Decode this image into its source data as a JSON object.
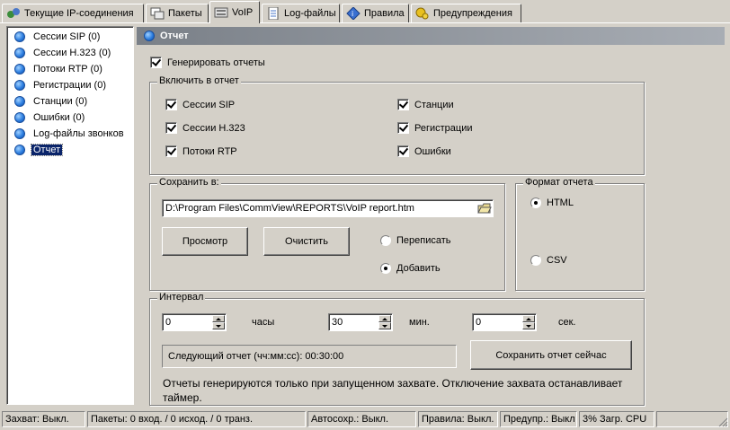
{
  "tabs": [
    {
      "label": "Текущие IP-соединения",
      "icon": "ip-connections-icon"
    },
    {
      "label": "Пакеты",
      "icon": "packets-icon"
    },
    {
      "label": "VoIP",
      "icon": "voip-icon"
    },
    {
      "label": "Log-файлы",
      "icon": "log-files-icon"
    },
    {
      "label": "Правила",
      "icon": "rules-icon"
    },
    {
      "label": "Предупреждения",
      "icon": "alerts-icon"
    }
  ],
  "sidebar": {
    "items": [
      {
        "label": "Сессии SIP  (0)"
      },
      {
        "label": "Сессии H.323 (0)"
      },
      {
        "label": "Потоки RTP (0)"
      },
      {
        "label": "Регистрации (0)"
      },
      {
        "label": "Станции (0)"
      },
      {
        "label": "Ошибки (0)"
      },
      {
        "label": "Log-файлы звонков"
      },
      {
        "label": "Отчет"
      }
    ]
  },
  "header": {
    "title": "Отчет"
  },
  "generate": {
    "label": "Генерировать отчеты",
    "checked": true
  },
  "include": {
    "legend": "Включить в отчет",
    "items": [
      {
        "label": "Сессии SIP",
        "checked": true
      },
      {
        "label": "Сессии H.323",
        "checked": true
      },
      {
        "label": "Потоки RTP",
        "checked": true
      },
      {
        "label": "Станции",
        "checked": true
      },
      {
        "label": "Регистрации",
        "checked": true
      },
      {
        "label": "Ошибки",
        "checked": true
      }
    ]
  },
  "save": {
    "legend": "Сохранить в:",
    "path": "D:\\Program Files\\CommView\\REPORTS\\VoIP report.htm",
    "view_button": "Просмотр",
    "clear_button": "Очистить",
    "overwrite": "Переписать",
    "append": "Добавить"
  },
  "format": {
    "legend": "Формат отчета",
    "html": "HTML",
    "csv": "CSV"
  },
  "interval": {
    "legend": "Интервал",
    "hours_value": "0",
    "hours_label": "часы",
    "minutes_value": "30",
    "minutes_label": "мин.",
    "seconds_value": "0",
    "seconds_label": "сек.",
    "next_report": "Следующий отчет (чч:мм:сс): 00:30:00",
    "save_now_button": "Сохранить отчет сейчас",
    "note": "Отчеты генерируются только при запущенном захвате. Отключение захвата останавливает таймер."
  },
  "statusbar": {
    "capture": "Захват: Выкл.",
    "packets": "Пакеты: 0 вход. / 0 исход. / 0 транз.",
    "autosave": "Автосохр.: Выкл.",
    "rules": "Правила: Выкл.",
    "alerts": "Предупр.: Выкл",
    "cpu": "3% Загр. CPU"
  }
}
